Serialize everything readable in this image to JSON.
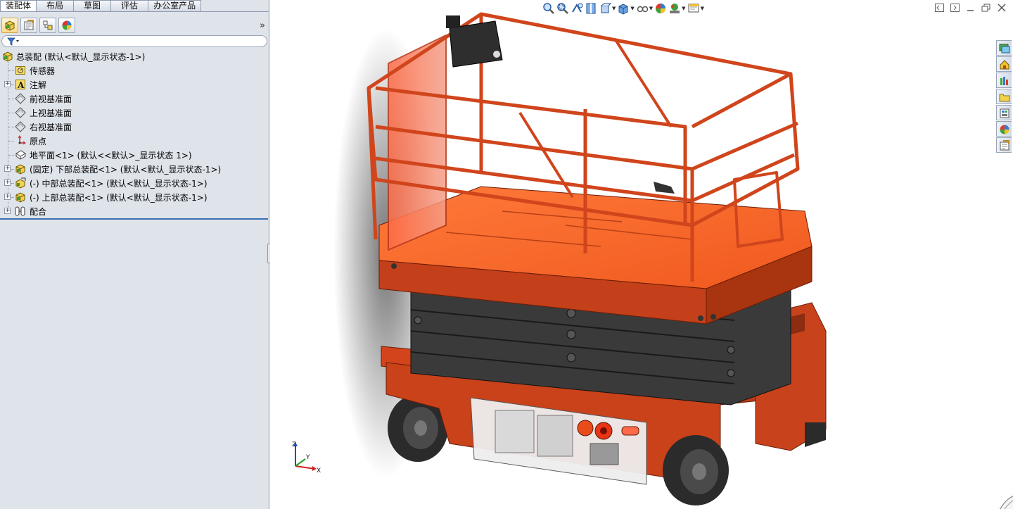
{
  "command_manager": {
    "tabs": [
      {
        "label": "装配体",
        "active": true
      },
      {
        "label": "布局",
        "active": false
      },
      {
        "label": "草图",
        "active": false
      },
      {
        "label": "评估",
        "active": false
      },
      {
        "label": "办公室产品",
        "active": false
      }
    ]
  },
  "feature_manager": {
    "toolbar": [
      "feature-manager-tree-icon",
      "property-manager-icon",
      "configuration-manager-icon",
      "display-manager-icon"
    ],
    "expand_symbol": "»"
  },
  "tree": {
    "root": "总装配  (默认<默认_显示状态-1>)",
    "items": [
      {
        "label": "传感器",
        "icon": "sensor-icon",
        "expandable": false
      },
      {
        "label": "注解",
        "icon": "annotation-icon",
        "expandable": true
      },
      {
        "label": "前视基准面",
        "icon": "plane-icon",
        "expandable": false
      },
      {
        "label": "上视基准面",
        "icon": "plane-icon",
        "expandable": false
      },
      {
        "label": "右视基准面",
        "icon": "plane-icon",
        "expandable": false
      },
      {
        "label": "原点",
        "icon": "origin-icon",
        "expandable": false
      },
      {
        "label": "地平面<1> (默认<<默认>_显示状态 1>)",
        "icon": "part-icon",
        "expandable": false
      },
      {
        "label": "(固定) 下部总装配<1> (默认<默认_显示状态-1>)",
        "icon": "assembly-icon",
        "expandable": true
      },
      {
        "label": "(-) 中部总装配<1> (默认<默认_显示状态-1>)",
        "icon": "assembly-edit-icon",
        "expandable": true
      },
      {
        "label": "(-) 上部总装配<1> (默认<默认_显示状态-1>)",
        "icon": "assembly-icon",
        "expandable": true
      },
      {
        "label": "配合",
        "icon": "mates-icon",
        "expandable": true
      }
    ]
  },
  "graphics": {
    "model": "scissor-lift-assembly",
    "triad": {
      "x": "X",
      "y": "Y",
      "z": "Z"
    },
    "colors": {
      "body": "#d9421a",
      "frame": "#c9441c",
      "scissor": "#3a3a3a",
      "deck": "#f26325"
    }
  }
}
